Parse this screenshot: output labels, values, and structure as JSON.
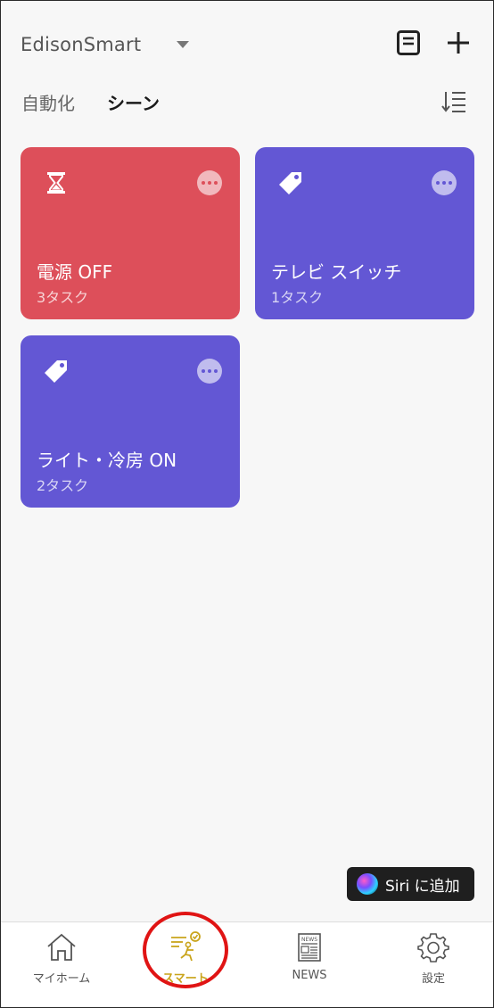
{
  "header": {
    "home_name": "EdisonSmart",
    "tabs": [
      {
        "label": "自動化",
        "active": false
      },
      {
        "label": "シーン",
        "active": true
      }
    ]
  },
  "scenes": [
    {
      "title": "電源 OFF",
      "tasks": "3タスク",
      "icon": "hourglass-icon",
      "color": "#dd4f5a"
    },
    {
      "title": "テレビ スイッチ",
      "tasks": "1タスク",
      "icon": "tag-icon",
      "color": "#6357d4"
    },
    {
      "title": "ライト・冷房 ON",
      "tasks": "2タスク",
      "icon": "tag-icon",
      "color": "#6357d4"
    }
  ],
  "siri": {
    "label": "Siri に追加"
  },
  "tabbar": [
    {
      "label": "マイホーム",
      "icon": "home-icon"
    },
    {
      "label": "スマート",
      "icon": "smart-icon",
      "active": true
    },
    {
      "label": "NEWS",
      "icon": "news-icon"
    },
    {
      "label": "設定",
      "icon": "gear-icon"
    }
  ],
  "colors": {
    "accent": "#c9a41b",
    "highlight_ring": "#e01414",
    "scene_red": "#dd4f5a",
    "scene_purple": "#6357d4"
  }
}
